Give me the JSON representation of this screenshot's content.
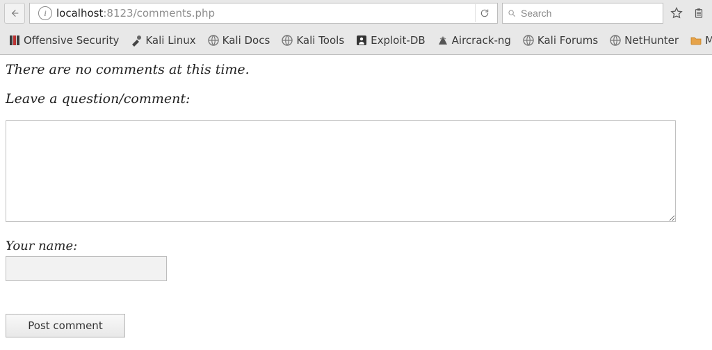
{
  "browser": {
    "url_host": "localhost",
    "url_rest": ":8123/comments.php",
    "search_placeholder": "Search"
  },
  "bookmarks": [
    {
      "label": "Offensive Security",
      "icon": "offsec"
    },
    {
      "label": "Kali Linux",
      "icon": "tool"
    },
    {
      "label": "Kali Docs",
      "icon": "globe"
    },
    {
      "label": "Kali Tools",
      "icon": "globe"
    },
    {
      "label": "Exploit-DB",
      "icon": "exploitdb"
    },
    {
      "label": "Aircrack-ng",
      "icon": "antenna"
    },
    {
      "label": "Kali Forums",
      "icon": "globe"
    },
    {
      "label": "NetHunter",
      "icon": "globe"
    },
    {
      "label": "Most",
      "icon": "folder"
    }
  ],
  "page": {
    "no_comments": "There are no comments at this time.",
    "leave_label": "Leave a question/comment:",
    "name_label": "Your name:",
    "comment_value": "",
    "name_value": "",
    "submit_label": "Post comment"
  }
}
